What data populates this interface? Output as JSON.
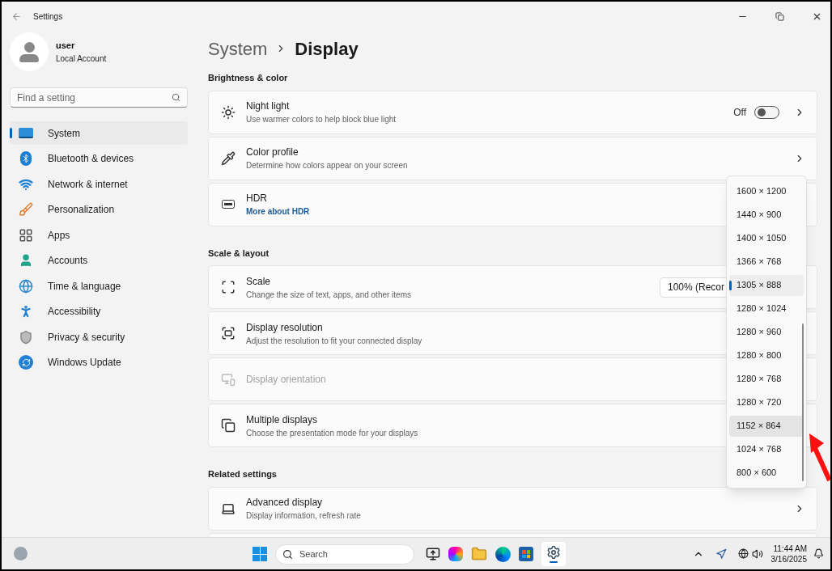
{
  "window": {
    "title": "Settings"
  },
  "account": {
    "name": "user",
    "type": "Local Account"
  },
  "search": {
    "placeholder": "Find a setting"
  },
  "nav": [
    {
      "label": "System",
      "selected": true
    },
    {
      "label": "Bluetooth & devices",
      "selected": false
    },
    {
      "label": "Network & internet",
      "selected": false
    },
    {
      "label": "Personalization",
      "selected": false
    },
    {
      "label": "Apps",
      "selected": false
    },
    {
      "label": "Accounts",
      "selected": false
    },
    {
      "label": "Time & language",
      "selected": false
    },
    {
      "label": "Accessibility",
      "selected": false
    },
    {
      "label": "Privacy & security",
      "selected": false
    },
    {
      "label": "Windows Update",
      "selected": false
    }
  ],
  "breadcrumb": [
    "System",
    "Display"
  ],
  "sections": [
    {
      "title": "Brightness & color",
      "cards": [
        {
          "title": "Night light",
          "subtitle": "Use warmer colors to help block blue light",
          "toggle": {
            "label": "Off",
            "on": false
          },
          "chevron": true
        },
        {
          "title": "Color profile",
          "subtitle": "Determine how colors appear on your screen",
          "chevron": true
        },
        {
          "title": "HDR",
          "link": "More about HDR"
        }
      ]
    },
    {
      "title": "Scale & layout",
      "cards": [
        {
          "title": "Scale",
          "subtitle": "Change the size of text, apps, and other items",
          "combo": "100% (Recor"
        },
        {
          "title": "Display resolution",
          "subtitle": "Adjust the resolution to fit your connected display"
        },
        {
          "title": "Display orientation",
          "disabled": true
        },
        {
          "title": "Multiple displays",
          "subtitle": "Choose the presentation mode for your displays"
        }
      ]
    },
    {
      "title": "Related settings",
      "cards": [
        {
          "title": "Advanced display",
          "subtitle": "Display information, refresh rate",
          "chevron": true
        }
      ]
    }
  ],
  "resolution_menu": [
    {
      "label": "1600 × 1200",
      "selected": false,
      "hovered": false
    },
    {
      "label": "1440 × 900",
      "selected": false,
      "hovered": false
    },
    {
      "label": "1400 × 1050",
      "selected": false,
      "hovered": false
    },
    {
      "label": "1366 × 768",
      "selected": false,
      "hovered": false
    },
    {
      "label": "1305 × 888",
      "selected": true,
      "hovered": false
    },
    {
      "label": "1280 × 1024",
      "selected": false,
      "hovered": false
    },
    {
      "label": "1280 × 960",
      "selected": false,
      "hovered": false
    },
    {
      "label": "1280 × 800",
      "selected": false,
      "hovered": false
    },
    {
      "label": "1280 × 768",
      "selected": false,
      "hovered": false
    },
    {
      "label": "1280 × 720",
      "selected": false,
      "hovered": false
    },
    {
      "label": "1152 × 864",
      "selected": false,
      "hovered": true
    },
    {
      "label": "1024 × 768",
      "selected": false,
      "hovered": false
    },
    {
      "label": "800 × 600",
      "selected": false,
      "hovered": false
    }
  ],
  "taskbar": {
    "search_placeholder": "Search",
    "time": "11:44 AM",
    "date": "3/16/2025"
  }
}
